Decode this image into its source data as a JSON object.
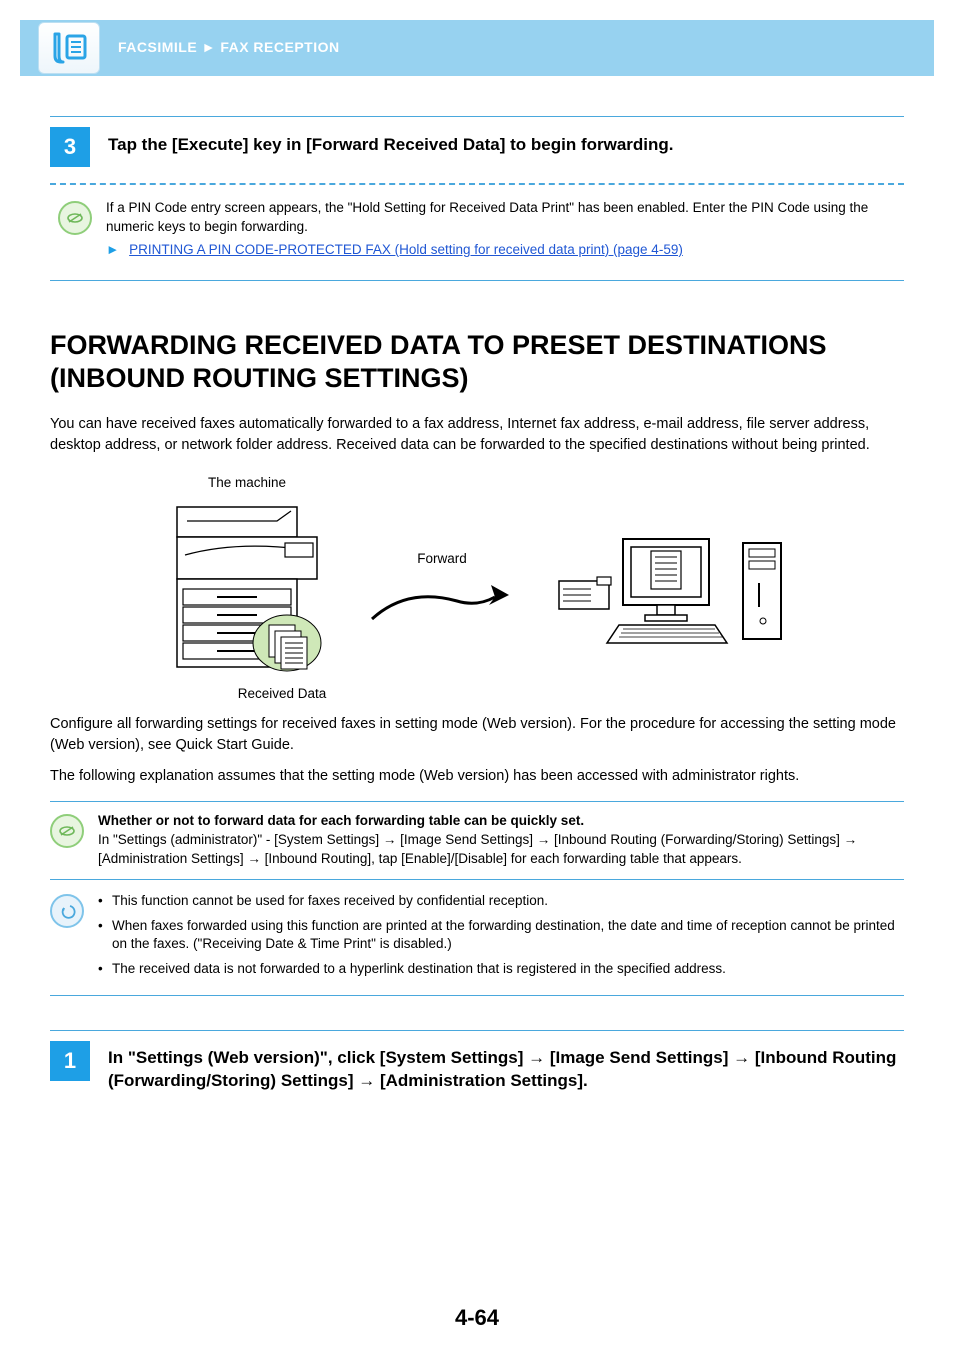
{
  "header": {
    "breadcrumb_a": "FACSIMILE",
    "breadcrumb_sep": "►",
    "breadcrumb_b": "FAX RECEPTION"
  },
  "step3": {
    "number": "3",
    "title": "Tap the [Execute] key in [Forward Received Data] to begin forwarding.",
    "note": "If a PIN Code entry screen appears, the \"Hold Setting for Received Data Print\" has been enabled. Enter the PIN Code using the numeric keys to begin forwarding.",
    "link_arrow": "►",
    "link_text": "PRINTING A PIN CODE-PROTECTED FAX (Hold setting for received data print) (page 4-59)"
  },
  "section": {
    "title": "FORWARDING RECEIVED DATA TO PRESET DESTINATIONS (INBOUND ROUTING SETTINGS)",
    "intro": "You can have received faxes automatically forwarded to a fax address, Internet fax address, e-mail address, file server address, desktop address, or network folder address. Received data can be forwarded to the specified destinations without being printed.",
    "diagram": {
      "machine_label": "The machine",
      "forward_label": "Forward",
      "received_label": "Received Data"
    },
    "para2": "Configure all forwarding settings for received faxes in setting mode (Web version). For the procedure for accessing the setting mode (Web version), see Quick Start Guide.",
    "para3": "The following explanation assumes that the setting mode (Web version) has been accessed with administrator rights."
  },
  "greenbox": {
    "bold": "Whether or not to forward data for each forwarding table can be quickly set.",
    "body": "In \"Settings (administrator)\" - [System Settings] → [Image Send Settings] → [Inbound Routing (Forwarding/Storing) Settings] → [Administration Settings] → [Inbound Routing], tap [Enable]/[Disable] for each forwarding table that appears."
  },
  "bluebox": {
    "items": [
      "This function cannot be used for faxes received by confidential reception.",
      "When faxes forwarded using this function are printed at the forwarding destination, the date and time of reception cannot be printed on the faxes. (\"Receiving Date & Time Print\" is disabled.)",
      "The received data is not forwarded to a hyperlink destination that is registered in the specified address."
    ]
  },
  "step1": {
    "number": "1",
    "title": "In \"Settings (Web version)\", click [System Settings] → [Image Send Settings] → [Inbound Routing (Forwarding/Storing) Settings] → [Administration Settings]."
  },
  "page_number": "4-64"
}
